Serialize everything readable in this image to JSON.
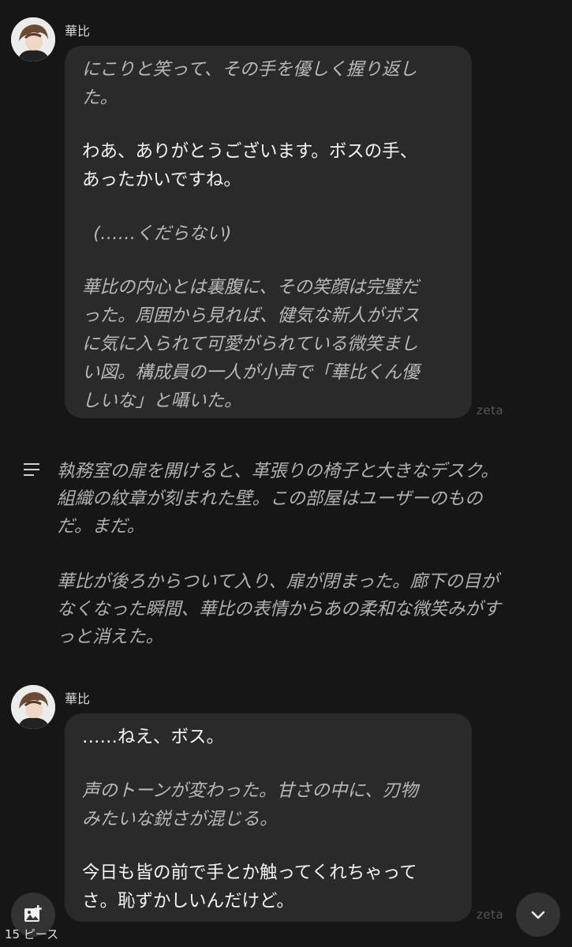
{
  "messages": [
    {
      "speaker": "華比",
      "lines": [
        {
          "text": "にこりと笑って、その手を優しく握り返し",
          "style": "italic"
        },
        {
          "text": "た。",
          "style": "italic"
        },
        {
          "text": "",
          "style": "gap"
        },
        {
          "text": "わあ、ありがとうございます。ボスの手、",
          "style": "plain"
        },
        {
          "text": "あったかいですね。",
          "style": "plain"
        },
        {
          "text": "",
          "style": "gap"
        },
        {
          "text": "  (……くだらない)",
          "style": "italic"
        },
        {
          "text": "",
          "style": "gap"
        },
        {
          "text": "華比の内心とは裏腹に、その笑顔は完璧だ",
          "style": "italic"
        },
        {
          "text": "った。周囲から見れば、健気な新人がボス",
          "style": "italic"
        },
        {
          "text": "に気に入られて可愛がられている微笑まし",
          "style": "italic"
        },
        {
          "text": "い図。構成員の一人が小声で「華比くん優",
          "style": "italic"
        },
        {
          "text": "しいな」と囁いた。",
          "style": "italic"
        }
      ],
      "watermark": "zeta"
    },
    {
      "speaker": "華比",
      "lines": [
        {
          "text": "……ねえ、ボス。",
          "style": "plain"
        },
        {
          "text": "",
          "style": "gap"
        },
        {
          "text": "声のトーンが変わった。甘さの中に、刃物",
          "style": "italic"
        },
        {
          "text": "みたいな鋭さが混じる。",
          "style": "italic"
        },
        {
          "text": "",
          "style": "gap"
        },
        {
          "text": "今日も皆の前で手とか触ってくれちゃって",
          "style": "plain"
        },
        {
          "text": "さ。恥ずかしいんだけど。",
          "style": "plain"
        }
      ],
      "watermark": "zeta"
    }
  ],
  "narration": {
    "icon": "narration-icon",
    "lines": [
      "執務室の扉を開けると、革張りの椅子と大きなデスク。",
      "組織の紋章が刻まれた壁。この部屋はユーザーのもの",
      "だ。まだ。",
      "",
      "華比が後ろからついて入り、扉が閉まった。廊下の目が",
      "なくなった瞬間、華比の表情からあの柔和な微笑みがす",
      "っと消えた。"
    ]
  },
  "footer": {
    "image_button_icon": "add-image-icon",
    "pieces_label": "15 ピース",
    "scroll_down_icon": "chevron-down-icon"
  },
  "colors": {
    "background": "#161616",
    "bubble": "#2a2a2a",
    "italic_text": "#b8b8b8",
    "plain_text": "#f2f2f2"
  }
}
